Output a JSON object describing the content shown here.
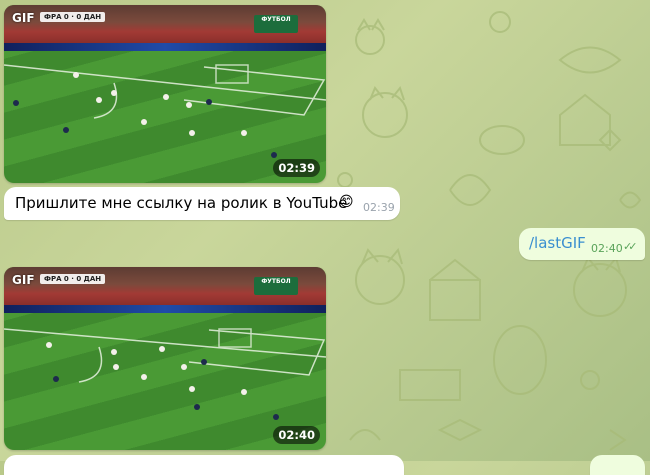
{
  "messages": [
    {
      "type": "gif",
      "label": "GIF",
      "score": "ФРА 0 · 0 ДАН",
      "channel": "ФУТБОЛ",
      "duration": "02:39"
    },
    {
      "type": "text_in",
      "text": "Пришлите мне ссылку на ролик в YouTube",
      "emoji": "😊",
      "time": "02:39"
    },
    {
      "type": "text_out",
      "text": "/lastGIF",
      "time": "02:40",
      "ticks": "✓✓"
    },
    {
      "type": "gif",
      "label": "GIF",
      "score": "ФРА 0 · 0 ДАН",
      "channel": "ФУТБОЛ",
      "duration": "02:40"
    }
  ],
  "colors": {
    "accent": "#3a8fd0",
    "out_bubble": "#effdde",
    "wallpaper": "#c3d192"
  }
}
